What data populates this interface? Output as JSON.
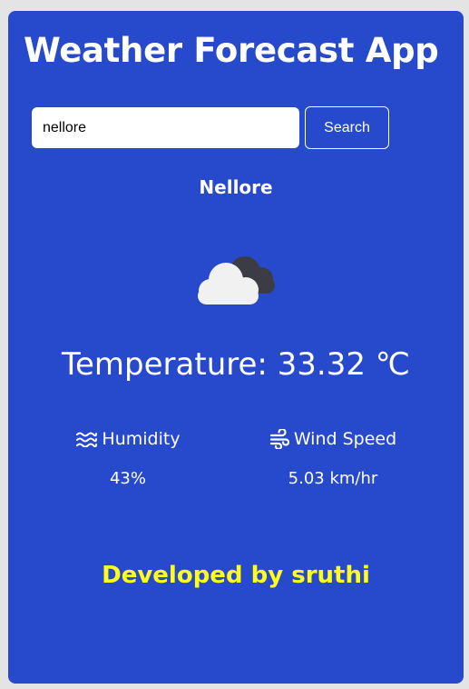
{
  "app": {
    "title": "Weather Forecast App"
  },
  "search": {
    "value": "nellore",
    "button_label": "Search"
  },
  "weather": {
    "city": "Nellore",
    "temperature_text": "Temperature: 33.32 ℃",
    "condition_icon": "cloud-icon"
  },
  "stats": {
    "humidity": {
      "label": "Humidity",
      "value": "43%",
      "icon": "water-waves-icon"
    },
    "wind": {
      "label": "Wind Speed",
      "value": "5.03 km/hr",
      "icon": "wind-icon"
    }
  },
  "footer": {
    "text": "Developed by sruthi"
  },
  "colors": {
    "page_background": "#e4e4e4",
    "card_background": "#2749cc",
    "text": "#ffffff",
    "footer_text": "#ffff1a"
  }
}
